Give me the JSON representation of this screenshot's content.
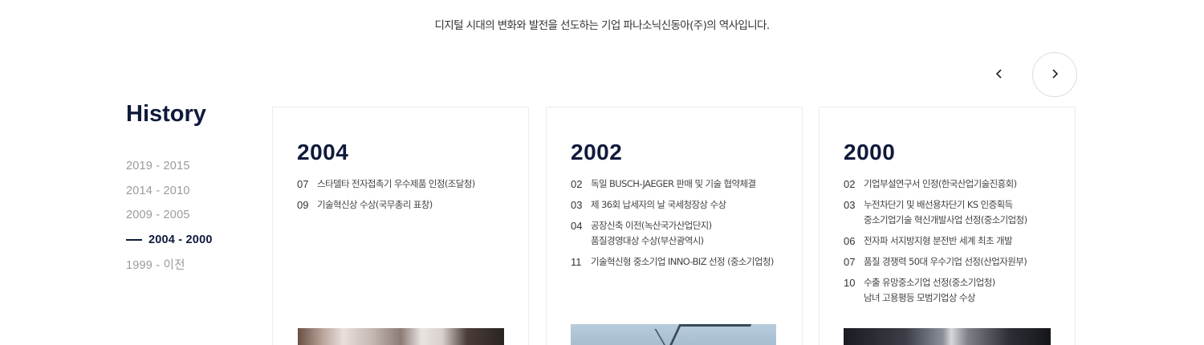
{
  "intro": "디지털 시대의 변화와 발전을 선도하는 기업 파나소닉신동아(주)의 역사입니다.",
  "nav": {
    "prev_icon": "chevron-left-icon",
    "next_icon": "chevron-right-icon"
  },
  "sidebar": {
    "title": "History",
    "items": [
      {
        "label": "2019  -  2015",
        "active": false
      },
      {
        "label": "2014  -  2010",
        "active": false
      },
      {
        "label": "2009  -  2005",
        "active": false
      },
      {
        "label": "2004  -  2000",
        "active": true
      },
      {
        "label": "1999  -  이전",
        "active": false
      }
    ]
  },
  "cards": [
    {
      "year": "2004",
      "events": [
        {
          "month": "07",
          "lines": [
            "스타델타 전자접촉기 우수제품 인정(조달청)"
          ]
        },
        {
          "month": "09",
          "lines": [
            "기술혁신상 수상(국무총리 표창)"
          ]
        }
      ]
    },
    {
      "year": "2002",
      "events": [
        {
          "month": "02",
          "lines": [
            "독일 BUSCH-JAEGER 판매 및 기술 협약체결"
          ]
        },
        {
          "month": "03",
          "lines": [
            "제 36회 납세자의 날 국세청장상 수상"
          ]
        },
        {
          "month": "04",
          "lines": [
            "공장신축 이전(녹산국가산업단지)",
            "품질경영대상 수상(부산광역시)"
          ]
        },
        {
          "month": "11",
          "lines": [
            "기술혁신형 중소기업 INNO-BIZ 선정 (중소기업청)"
          ]
        }
      ]
    },
    {
      "year": "2000",
      "events": [
        {
          "month": "02",
          "lines": [
            "기업부설연구서 인정(한국산업기술진흥회)"
          ]
        },
        {
          "month": "03",
          "lines": [
            "누전차단기 및 배선용차단기 KS 인증획득",
            "중소기업기술 혁신개발사업 선정(중소기업청)"
          ]
        },
        {
          "month": "06",
          "lines": [
            "전자파 서지방지형 분전반 세계 최초 개발"
          ]
        },
        {
          "month": "07",
          "lines": [
            "품질 경쟁력 50대 우수기업 선정(산업자원부)"
          ]
        },
        {
          "month": "10",
          "lines": [
            "수출 유망중소기업 선정(중소기업청)",
            "남녀 고용평등 모범기업상 수상"
          ]
        }
      ]
    }
  ]
}
